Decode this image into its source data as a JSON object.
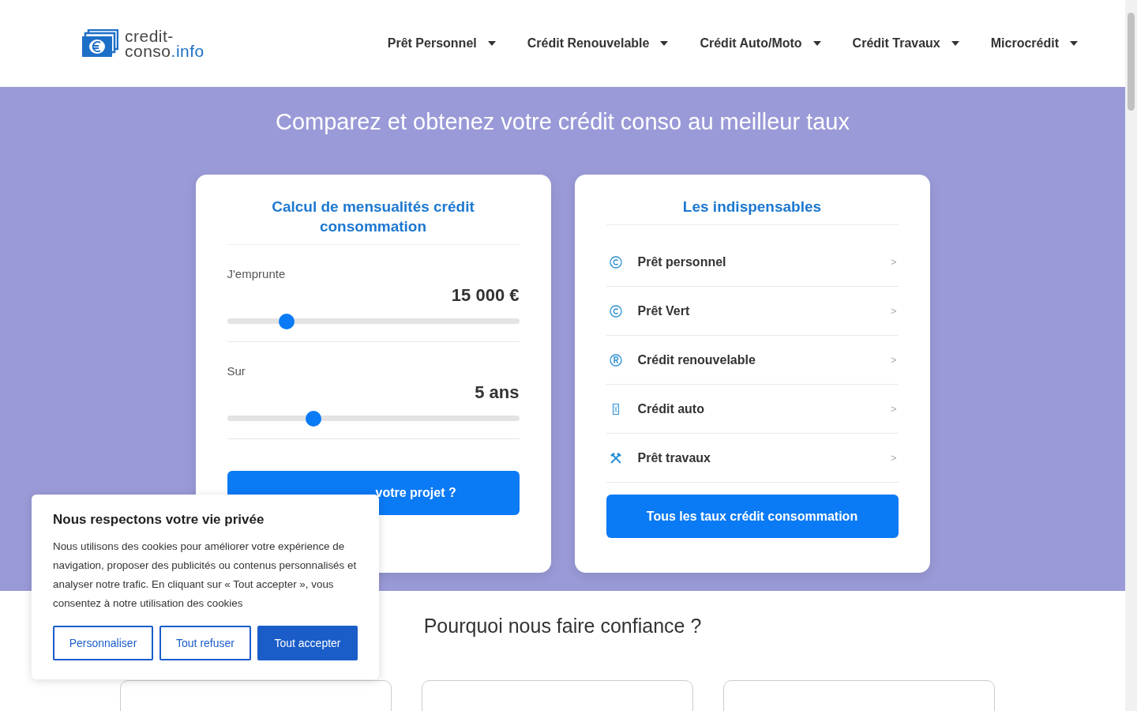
{
  "logo": {
    "line1": "credit-",
    "line2a": "conso",
    "line2b": ".info"
  },
  "nav": [
    {
      "label": "Prêt Personnel"
    },
    {
      "label": "Crédit Renouvelable"
    },
    {
      "label": "Crédit Auto/Moto"
    },
    {
      "label": "Crédit Travaux"
    },
    {
      "label": "Microcrédit"
    }
  ],
  "hero": {
    "title": "Comparez et obtenez votre crédit conso au meilleur taux"
  },
  "calculator": {
    "title": "Calcul de mensualités crédit consommation",
    "sliders": [
      {
        "label": "J'emprunte",
        "value": "15 000 €",
        "level": 0.205
      },
      {
        "label": "Sur",
        "value": "5 ans",
        "level": 0.297
      }
    ],
    "button": "votre projet ?"
  },
  "essentials": {
    "title": "Les indispensables",
    "items": [
      {
        "kind": "copyright",
        "label": "Prêt personnel",
        "arrow": ">"
      },
      {
        "kind": "copyright",
        "label": "Prêt Vert",
        "arrow": ">"
      },
      {
        "kind": "registered",
        "label": "Crédit renouvelable",
        "arrow": ">"
      },
      {
        "kind": "box",
        "label": "Crédit auto",
        "arrow": ">"
      },
      {
        "kind": "tools",
        "label": "Prêt travaux",
        "arrow": ">"
      }
    ],
    "button": "Tous les taux crédit consommation"
  },
  "trust": {
    "title": "Pourquoi nous faire confiance ?"
  },
  "cookie": {
    "title": "Nous respectons votre vie privée",
    "text": "Nous utilisons des cookies pour améliorer votre expérience de navigation, proposer des publicités ou contenus personnalisés et analyser notre trafic. En cliquant sur « Tout accepter », vous consentez à notre utilisation des cookies",
    "buttons": [
      {
        "label": "Personnaliser",
        "kind": "outline"
      },
      {
        "label": "Tout refuser",
        "kind": "outline"
      },
      {
        "label": "Tout accepter",
        "kind": "primary"
      }
    ]
  }
}
